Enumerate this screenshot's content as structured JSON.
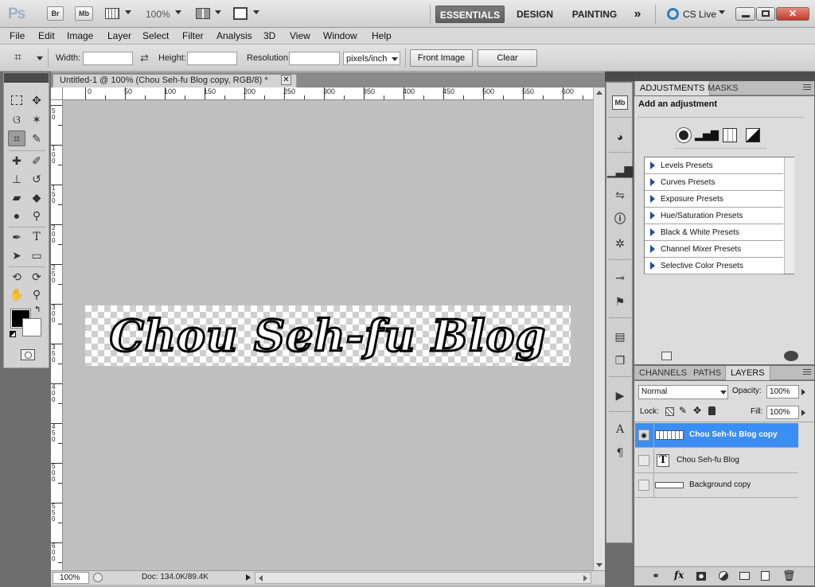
{
  "app": {
    "logo": "Ps",
    "bridge_label": "Br",
    "minibridge_label": "Mb",
    "zoom": "100%",
    "workspaces": [
      "ESSENTIALS",
      "DESIGN",
      "PAINTING"
    ],
    "more_workspaces": "»",
    "cslive": "CS Live"
  },
  "menu": [
    "File",
    "Edit",
    "Image",
    "Layer",
    "Select",
    "Filter",
    "Analysis",
    "3D",
    "View",
    "Window",
    "Help"
  ],
  "options": {
    "width_label": "Width:",
    "width_value": "",
    "height_label": "Height:",
    "height_value": "",
    "resolution_label": "Resolution:",
    "resolution_value": "",
    "units": "pixels/inch",
    "front_image": "Front Image",
    "clear": "Clear"
  },
  "document": {
    "tab_title": "Untitled-1 @ 100% (Chou Seh-fu Blog copy, RGB/8) *",
    "banner_text": "Chou Seh-fu Blog",
    "ruler_top": [
      "0",
      "50",
      "100",
      "150",
      "200",
      "250",
      "300",
      "350",
      "400",
      "450",
      "500",
      "550",
      "600"
    ],
    "ruler_left": [
      "50",
      "100",
      "150",
      "200",
      "250",
      "300",
      "350",
      "400",
      "450",
      "500",
      "550",
      "600"
    ],
    "status_zoom": "100%",
    "status_doc": "Doc: 134.0K/89.4K"
  },
  "adjustments": {
    "tabs": [
      "ADJUSTMENTS",
      "MASKS"
    ],
    "heading": "Add an adjustment",
    "presets": [
      "Levels Presets",
      "Curves Presets",
      "Exposure Presets",
      "Hue/Saturation Presets",
      "Black & White Presets",
      "Channel Mixer Presets",
      "Selective Color Presets"
    ]
  },
  "layers_panel": {
    "tabs": [
      "CHANNELS",
      "PATHS",
      "LAYERS"
    ],
    "blend_mode": "Normal",
    "opacity_label": "Opacity:",
    "opacity": "100%",
    "lock_label": "Lock:",
    "fill_label": "Fill:",
    "fill": "100%",
    "layers": [
      {
        "name": "Chou Seh-fu Blog copy",
        "selected": true,
        "visible": true
      },
      {
        "name": "Chou Seh-fu Blog",
        "selected": false,
        "visible": false
      },
      {
        "name": "Background copy",
        "selected": false,
        "visible": false
      }
    ]
  }
}
